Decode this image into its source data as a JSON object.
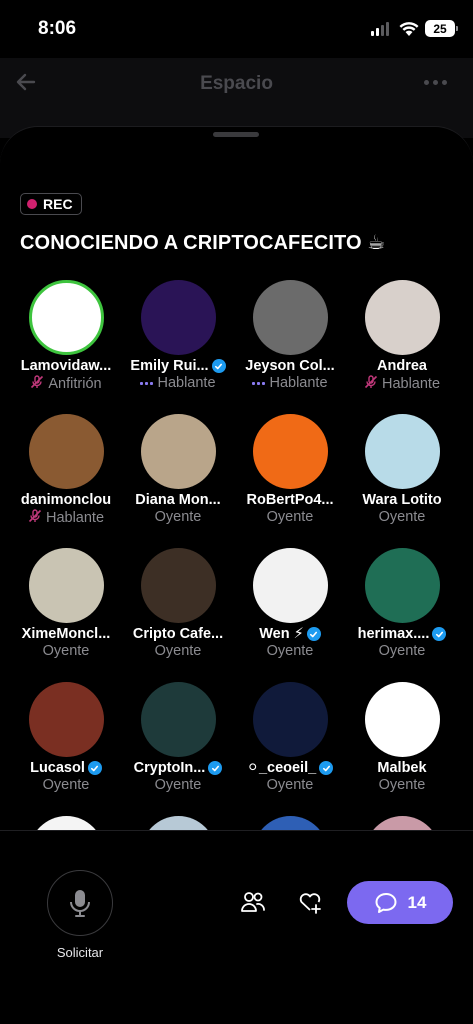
{
  "status_bar": {
    "time": "8:06",
    "battery": "25"
  },
  "header": {
    "title": "Espacio"
  },
  "space": {
    "rec_label": "REC",
    "title": "CONOCIENDO A CRIPTOCAFECITO ☕"
  },
  "participants": [
    {
      "name": "Lamovidaw...",
      "role": "Anfitrión",
      "verified": false,
      "status": "muted",
      "avatar_color": "#ffffff"
    },
    {
      "name": "Emily Rui...",
      "role": "Hablante",
      "verified": true,
      "status": "speaking",
      "avatar_color": "#2a1456"
    },
    {
      "name": "Jeyson Col...",
      "role": "Hablante",
      "verified": false,
      "status": "speaking",
      "avatar_color": "#6b6b6b"
    },
    {
      "name": "Andrea",
      "role": "Hablante",
      "verified": false,
      "status": "muted",
      "avatar_color": "#d8d0cb"
    },
    {
      "name": "danimonclou",
      "role": "Hablante",
      "verified": false,
      "status": "muted",
      "avatar_color": "#8a5a32"
    },
    {
      "name": "Diana Mon...",
      "role": "Oyente",
      "verified": false,
      "status": "none",
      "avatar_color": "#b9a58a"
    },
    {
      "name": "RoBertPo4...",
      "role": "Oyente",
      "verified": false,
      "status": "none",
      "avatar_color": "#f06a16"
    },
    {
      "name": "Wara Lotito",
      "role": "Oyente",
      "verified": false,
      "status": "none",
      "avatar_color": "#b8dbe8"
    },
    {
      "name": "XimeMoncl...",
      "role": "Oyente",
      "verified": false,
      "status": "none",
      "avatar_color": "#c9c4b3"
    },
    {
      "name": "Cripto Cafe...",
      "role": "Oyente",
      "verified": false,
      "status": "none",
      "avatar_color": "#3d2f25"
    },
    {
      "name": "Wen ⚡",
      "role": "Oyente",
      "verified": true,
      "status": "none",
      "avatar_color": "#f2f2f2"
    },
    {
      "name": "herimax....",
      "role": "Oyente",
      "verified": true,
      "status": "none",
      "avatar_color": "#1f6e55"
    },
    {
      "name": "Lucasol",
      "role": "Oyente",
      "verified": true,
      "status": "none",
      "avatar_color": "#7a2f22"
    },
    {
      "name": "CryptoIn...",
      "role": "Oyente",
      "verified": true,
      "status": "none",
      "avatar_color": "#1e3a3a"
    },
    {
      "name": "⚪_ceoeil_",
      "role": "Oyente",
      "verified": true,
      "status": "none",
      "avatar_color": "#101a3a"
    },
    {
      "name": "Malbek",
      "role": "Oyente",
      "verified": false,
      "status": "none",
      "avatar_color": "#ffffff"
    },
    {
      "name": "",
      "role": "",
      "verified": false,
      "status": "none",
      "avatar_color": "#f4f4f4"
    },
    {
      "name": "",
      "role": "",
      "verified": false,
      "status": "none",
      "avatar_color": "#b7c9d6"
    },
    {
      "name": "",
      "role": "",
      "verified": false,
      "status": "none",
      "avatar_color": "#2e5fb5"
    },
    {
      "name": "",
      "role": "",
      "verified": false,
      "status": "none",
      "avatar_color": "#c99aa7"
    }
  ],
  "bottom_bar": {
    "request_label": "Solicitar",
    "comment_count": "14"
  },
  "colors": {
    "accent": "#7c69f0",
    "verified": "#1d9bf0",
    "rec": "#d0206e",
    "muted": "#c0387a"
  }
}
